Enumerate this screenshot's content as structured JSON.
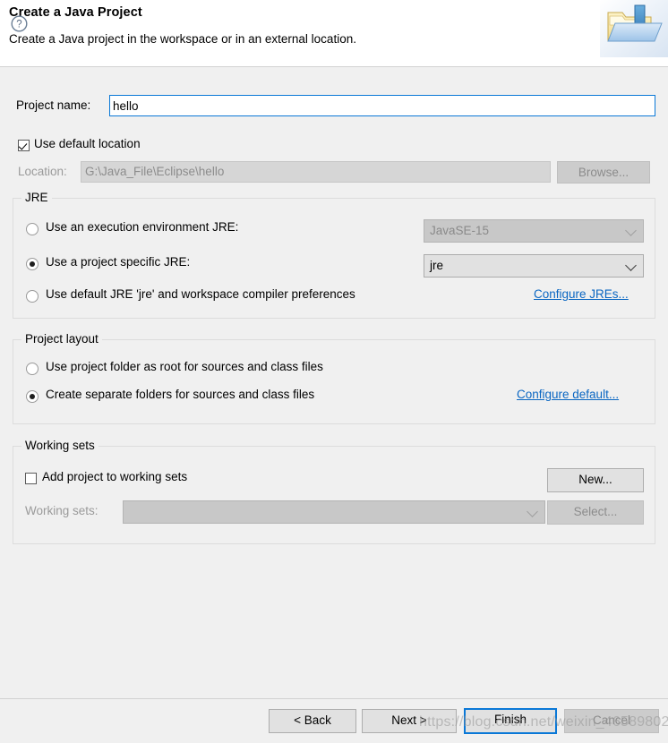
{
  "header": {
    "title": "Create a Java Project",
    "description": "Create a Java project in the workspace or in an external location.",
    "icon": "new-java-project-folder-icon"
  },
  "project_name": {
    "label": "Project name:",
    "value": "hello",
    "placeholder": ""
  },
  "location": {
    "use_default_label": "Use default location",
    "use_default_checked": true,
    "label": "Location:",
    "value": "G:\\Java_File\\Eclipse\\hello",
    "browse_label": "Browse...",
    "browse_enabled": false
  },
  "jre": {
    "group_title": "JRE",
    "options": [
      {
        "label": "Use an execution environment JRE:",
        "selected": false,
        "combo_value": "JavaSE-15",
        "combo_enabled": false
      },
      {
        "label": "Use a project specific JRE:",
        "selected": true,
        "combo_value": "jre",
        "combo_enabled": true
      },
      {
        "label": "Use default JRE 'jre' and workspace compiler preferences",
        "selected": false
      }
    ],
    "configure_link": "Configure JREs..."
  },
  "project_layout": {
    "group_title": "Project layout",
    "options": [
      {
        "label": "Use project folder as root for sources and class files",
        "selected": false
      },
      {
        "label": "Create separate folders for sources and class files",
        "selected": true
      }
    ],
    "configure_link": "Configure default..."
  },
  "working_sets": {
    "group_title": "Working sets",
    "add_label": "Add project to working sets",
    "add_checked": false,
    "label": "Working sets:",
    "combo_value": "",
    "combo_enabled": false,
    "new_label": "New...",
    "new_enabled": true,
    "select_label": "Select...",
    "select_enabled": false
  },
  "footer": {
    "help_icon": "question-mark-help-icon",
    "back_label": "< Back",
    "next_label": "Next >",
    "finish_label": "Finish",
    "cancel_label": "Cancel"
  },
  "watermark": {
    "text": "https://blog.csdn.net/weixin_46589802"
  },
  "colors": {
    "accent": "#0a78d7",
    "link": "#0a66c2",
    "dialog_bg": "#f0f0f0",
    "header_bg": "#ffffff"
  }
}
